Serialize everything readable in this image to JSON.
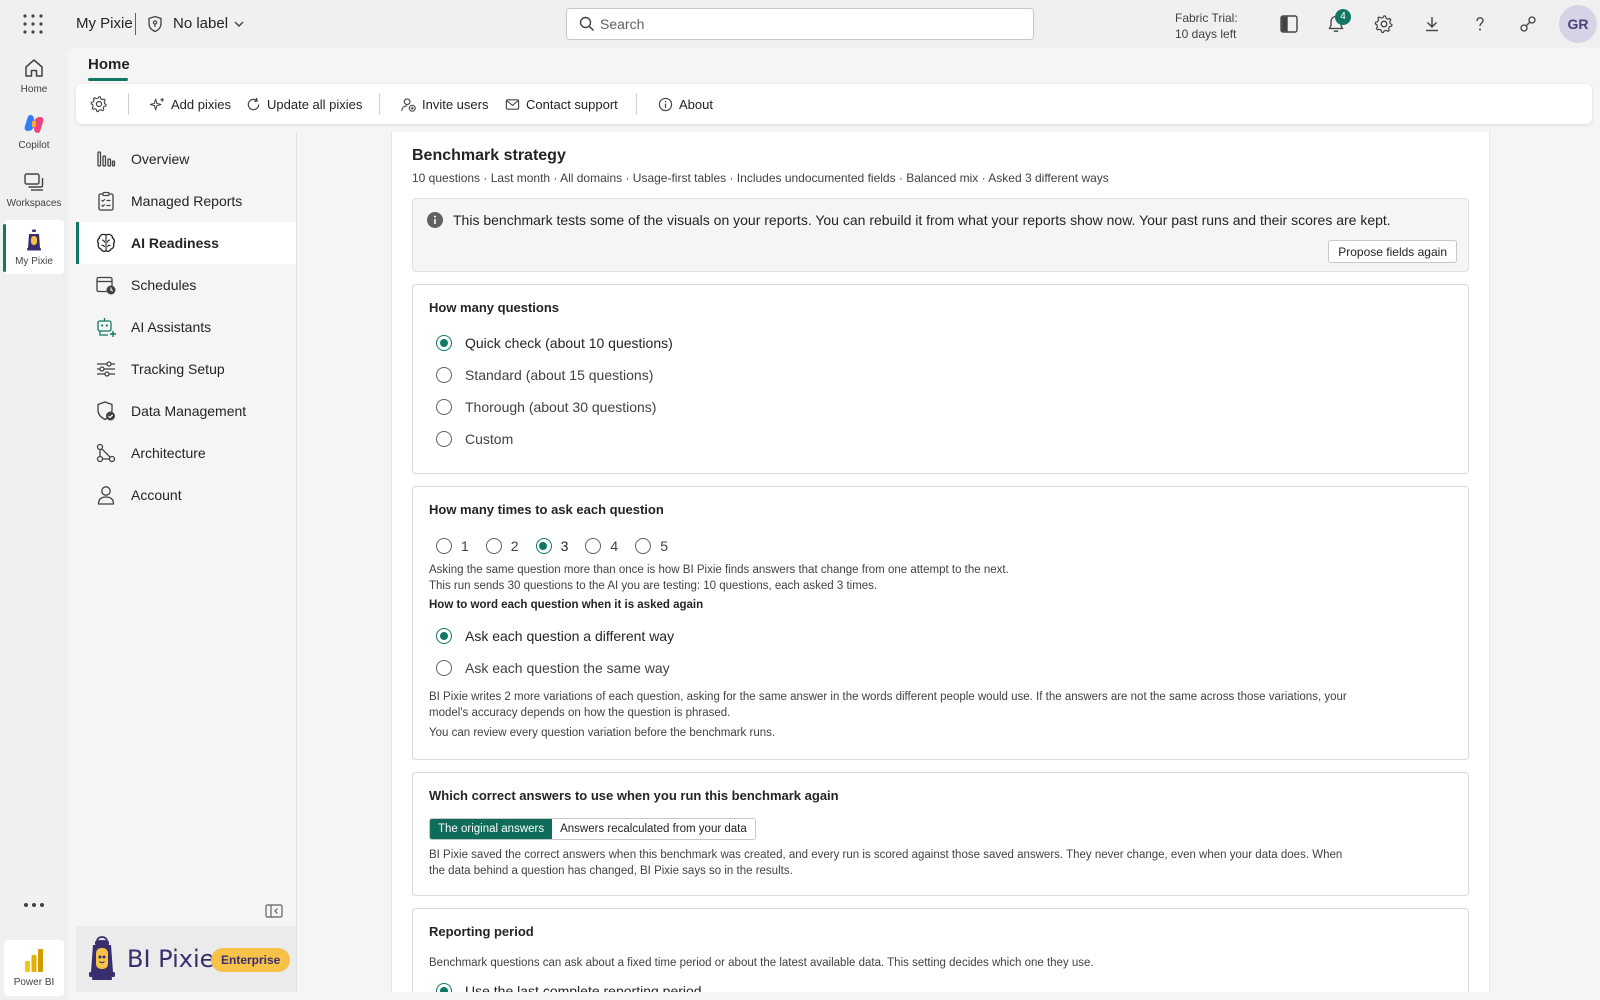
{
  "topbar": {
    "app_name": "My Pixie",
    "sensitivity_label": "No label",
    "search_placeholder": "Search",
    "trial_line1": "Fabric Trial:",
    "trial_line2": "10 days left",
    "notification_count": "4",
    "avatar_initials": "GR"
  },
  "rail": {
    "home": "Home",
    "copilot": "Copilot",
    "workspaces": "Workspaces",
    "my_pixie": "My Pixie",
    "power_bi": "Power BI"
  },
  "page": {
    "tab": "Home"
  },
  "toolbar": {
    "add_pixies": "Add pixies",
    "update_all": "Update all pixies",
    "invite_users": "Invite users",
    "contact_support": "Contact support",
    "about": "About"
  },
  "nav": {
    "items": [
      {
        "label": "Overview",
        "icon": "chart-bars-icon"
      },
      {
        "label": "Managed Reports",
        "icon": "clipboard-checklist-icon"
      },
      {
        "label": "AI Readiness",
        "icon": "brain-icon"
      },
      {
        "label": "Schedules",
        "icon": "calendar-clock-icon"
      },
      {
        "label": "AI Assistants",
        "icon": "bot-icon"
      },
      {
        "label": "Tracking Setup",
        "icon": "sliders-icon"
      },
      {
        "label": "Data Management",
        "icon": "shield-check-icon"
      },
      {
        "label": "Architecture",
        "icon": "flow-icon"
      },
      {
        "label": "Account",
        "icon": "person-icon"
      }
    ],
    "active_index": 2
  },
  "brand": {
    "name": "BI Pixie",
    "badge": "Enterprise"
  },
  "content": {
    "title": "Benchmark strategy",
    "subtitle": "10 questions · Last month · All domains · Usage-first tables · Includes undocumented fields · Balanced mix · Asked 3 different ways",
    "info_text": "This benchmark tests some of the visuals on your reports. You can rebuild it from what your reports show now. Your past runs and their scores are kept.",
    "propose_button": "Propose fields again",
    "questions": {
      "title": "How many questions",
      "options": [
        "Quick check (about 10 questions)",
        "Standard (about 15 questions)",
        "Thorough (about 30 questions)",
        "Custom"
      ],
      "selected": "Quick check (about 10 questions)"
    },
    "repeats": {
      "title": "How many times to ask each question",
      "options": [
        "1",
        "2",
        "3",
        "4",
        "5"
      ],
      "selected": "3",
      "help_line1": "Asking the same question more than once is how BI Pixie finds answers that change from one attempt to the next.",
      "help_line2": "This run sends 30 questions to the AI you are testing: 10 questions, each asked 3 times.",
      "wording_title": "How to word each question when it is asked again",
      "wording_options": [
        "Ask each question a different way",
        "Ask each question the same way"
      ],
      "wording_selected": "Ask each question a different way",
      "wording_help_line1": "BI Pixie writes 2 more variations of each question, asking for the same answer in the words different people would use. If the answers are not the same across those variations, your",
      "wording_help_line2": "model's accuracy depends on how the question is phrased.",
      "wording_help_line3": "You can review every question variation before the benchmark runs."
    },
    "answers": {
      "title": "Which correct answers to use when you run this benchmark again",
      "options": [
        "The original answers",
        "Answers recalculated from your data"
      ],
      "selected": "The original answers",
      "help_line1": "BI Pixie saved the correct answers when this benchmark was created, and every run is scored against those saved answers. They never change, even when your data does. When",
      "help_line2": "the data behind a question has changed, BI Pixie says so in the results."
    },
    "period": {
      "title": "Reporting period",
      "help": "Benchmark questions can ask about a fixed time period or about the latest available data. This setting decides which one they use.",
      "first_option": "Use the last complete reporting period"
    }
  },
  "colors": {
    "accent": "#117865",
    "brand_purple": "#3b2e6e",
    "badge_yellow": "#f6c247"
  }
}
